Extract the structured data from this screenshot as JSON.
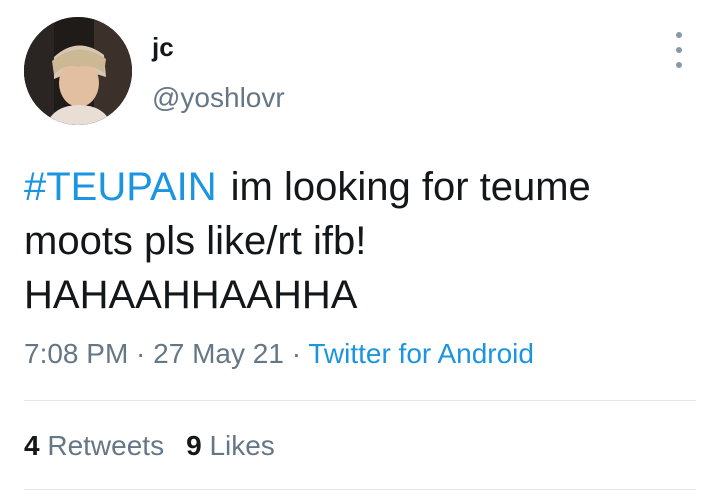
{
  "user": {
    "display_name": "jc",
    "handle": "@yoshlovr"
  },
  "tweet": {
    "hashtag": "#TEUPAIN",
    "text": "im looking for teume moots pls like/rt ifb! HAHAAHHAAHHA"
  },
  "meta": {
    "time": "7:08 PM",
    "sep1": " · ",
    "date": "27 May 21",
    "sep2": " · ",
    "source": "Twitter for Android"
  },
  "stats": {
    "retweets_count": "4",
    "retweets_label": "Retweets",
    "likes_count": "9",
    "likes_label": "Likes"
  },
  "colors": {
    "link": "#1b95e0",
    "secondary_text": "#657786",
    "divider": "#e1e8ed"
  }
}
